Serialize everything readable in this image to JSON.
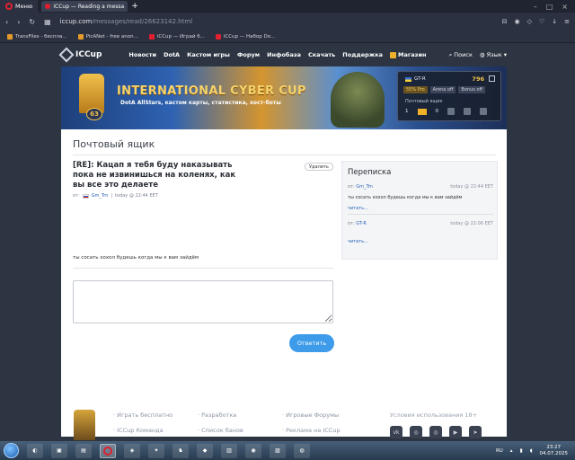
{
  "browser": {
    "menu_label": "Меню",
    "tab_title": "iCCup — Reading a messa",
    "url_domain": "iccup.com",
    "url_path": "/messages/read/26623142.html",
    "bookmarks": [
      "TransFiles - беспла...",
      "PicANet - free anon...",
      "iCCup — Играй б...",
      "iCCup — Набор Do..."
    ]
  },
  "site_nav": {
    "logo": "ICCup",
    "items": [
      "Новости",
      "DotA",
      "Кастом игры",
      "Форум",
      "Инфобаза",
      "Скачать",
      "Поддержка"
    ],
    "shop": "Магазин",
    "search": "Поиск",
    "language": "Язык"
  },
  "banner": {
    "level": "63",
    "title": "INTERNATIONAL CYBER CUP",
    "subtitle": "DotA AllStars, кастом карты, статистика, хост-боты"
  },
  "userbox": {
    "username": "GT-R",
    "coins": "796",
    "pill_1": "55% Pro",
    "pill_2": "Arena off",
    "pill_3": "Bonus off",
    "mail_label": "Почтовый ящик",
    "mail_count": "1",
    "count_2": "0"
  },
  "page": {
    "title": "Почтовый ящик"
  },
  "message": {
    "subject": "[RE]: Кацап я тебя буду наказывать пока не извинишься на коленях, как вы все это делаете",
    "delete_label": "Удалить",
    "from_prefix": "от:",
    "author": "Gm_Trn",
    "date": "today @ 22:44 EET",
    "body": "ты сосать хохол будешь когда мы к вам зайдём",
    "reply_label": "Ответить"
  },
  "conversation": {
    "title": "Переписка",
    "items": [
      {
        "from_prefix": "от:",
        "author": "Gm_Trn",
        "date": "today @ 22:44 EET",
        "text": "ты сосать хохол будешь когда мы к вам зайдём",
        "read_label": "читать..."
      },
      {
        "from_prefix": "от:",
        "author": "GT-R",
        "date": "today @ 22:06 EET",
        "text": "",
        "read_label": "читать..."
      }
    ]
  },
  "footer": {
    "col1": [
      "Играть бесплатно",
      "ICCup Команда"
    ],
    "col2": [
      "Разработка",
      "Список банов"
    ],
    "col3": [
      "Игровые Форумы",
      "Реклама на ICCup"
    ],
    "terms": "Условия использования 18+"
  },
  "taskbar": {
    "language": "RU",
    "time": "23:27",
    "date": "04.07.2025"
  }
}
